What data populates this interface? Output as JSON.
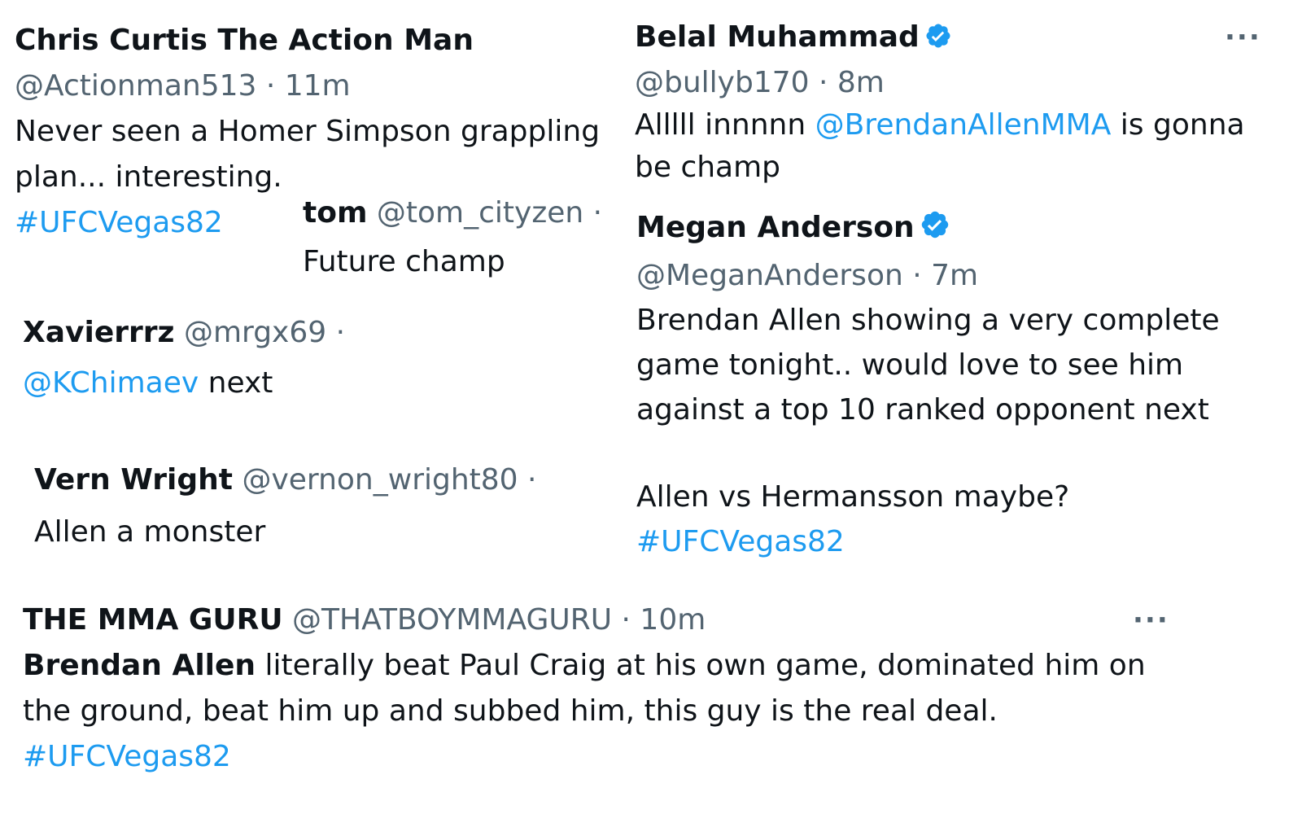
{
  "tweets": {
    "chris": {
      "name": "Chris Curtis The Action Man",
      "handle": "@Actionman513",
      "sep": " · ",
      "time": "11m",
      "line1": "Never seen a Homer Simpson grappling",
      "line2": "plan... interesting.",
      "hashtag": "#UFCVegas82"
    },
    "belal": {
      "name": "Belal Muhammad",
      "handle": "@bullyb170",
      "sep": " · ",
      "time": "8m",
      "text_before": "Alllll innnnn ",
      "mention": "@BrendanAllenMMA",
      "text_after": " is gonna",
      "line2": "be champ",
      "more": "···"
    },
    "tom": {
      "name": "tom",
      "handle": "@tom_cityzen",
      "sep": " ·",
      "text": "Future champ"
    },
    "megan": {
      "name": "Megan Anderson",
      "handle": "@MeganAnderson",
      "sep": " · ",
      "time": "7m",
      "line1": "Brendan Allen showing a very complete",
      "line2": "game tonight.. would love to see him",
      "line3": "against a top 10 ranked opponent next",
      "line4": "Allen vs Hermansson maybe?",
      "hashtag": "#UFCVegas82"
    },
    "xavier": {
      "name": "Xavierrrz",
      "handle": "@mrgx69",
      "sep": " ·",
      "mention": "@KChimaev",
      "text_after": " next"
    },
    "vern": {
      "name": "Vern Wright",
      "handle": "@vernon_wright80",
      "sep": " ·",
      "text": "Allen a monster"
    },
    "guru": {
      "name": "THE MMA GURU",
      "handle": "@THATBOYMMAGURU",
      "sep": " · ",
      "time": "10m",
      "bold_text": "Brendan Allen",
      "line1_rest": " literally beat Paul Craig at his own game, dominated him on",
      "line2": "the ground, beat him up and subbed him, this guy is the real deal.",
      "hashtag": "#UFCVegas82",
      "more": "···"
    }
  },
  "colors": {
    "text": "#0f1419",
    "secondary": "#536471",
    "link": "#1d9bf0",
    "verified": "#1d9bf0"
  },
  "icons": {
    "verified": "verified-badge-icon",
    "more": "more-options-icon"
  }
}
